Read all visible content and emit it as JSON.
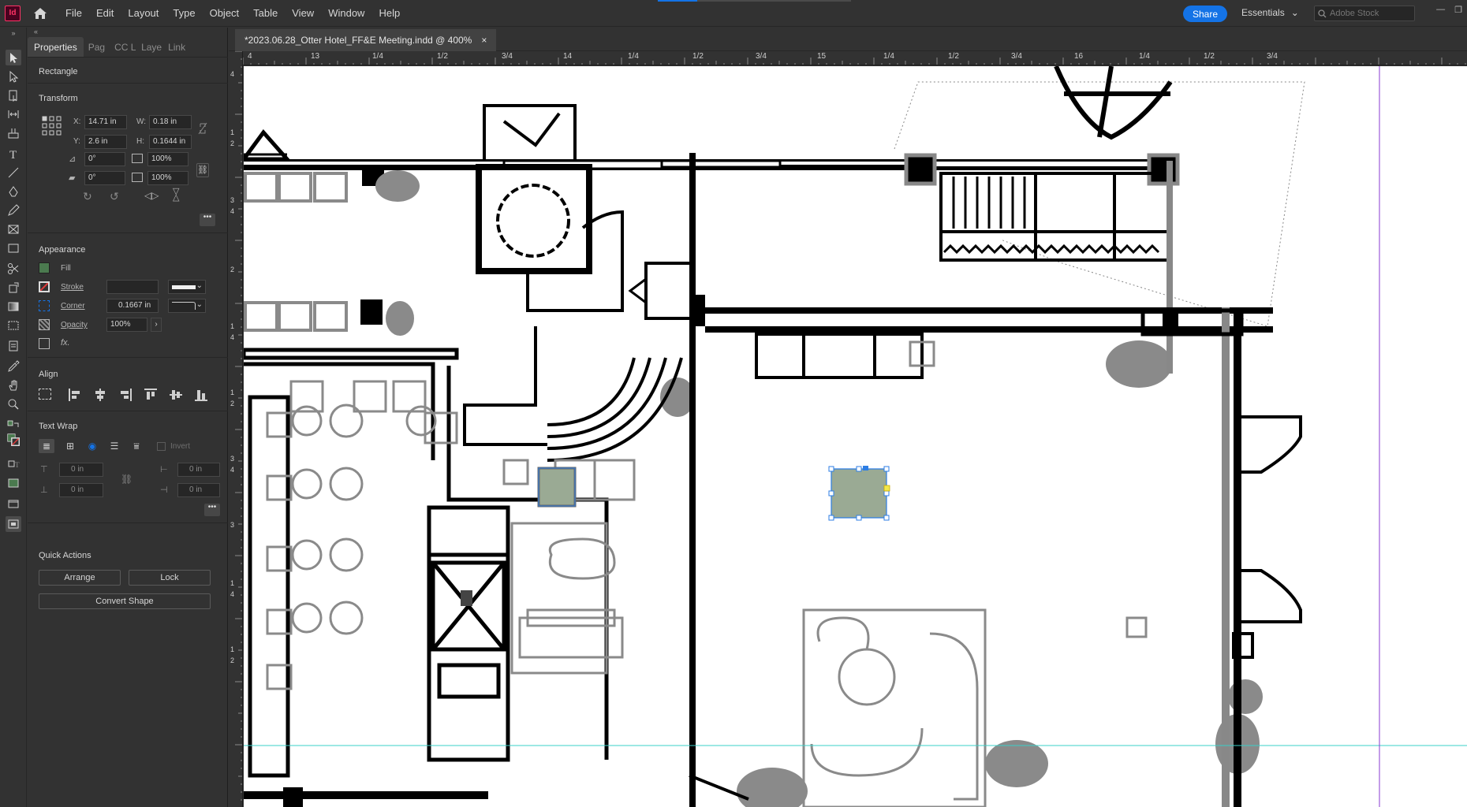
{
  "app": {
    "logo": "Id",
    "menu": [
      "File",
      "Edit",
      "Layout",
      "Type",
      "Object",
      "Table",
      "View",
      "Window",
      "Help"
    ],
    "share_label": "Share",
    "workspace_label": "Essentials",
    "stock_placeholder": "Adobe Stock"
  },
  "document": {
    "tab_title": "*2023.06.28_Otter Hotel_FF&E Meeting.indd @ 400%",
    "close_glyph": "×"
  },
  "panel": {
    "tabs": [
      "Properties",
      "Pag",
      "CC L",
      "Laye",
      "Link"
    ],
    "object_type": "Rectangle",
    "transform": {
      "title": "Transform",
      "x_label": "X:",
      "x": "14.71 in",
      "y_label": "Y:",
      "y": "2.6 in",
      "w_label": "W:",
      "w": "0.18 in",
      "h_label": "H:",
      "h": "0.1644 in",
      "rotate": "0°",
      "shear": "0°",
      "scale_x": "100%",
      "scale_y": "100%"
    },
    "appearance": {
      "title": "Appearance",
      "fill_label": "Fill",
      "fill_color": "#4b7a4f",
      "stroke_label": "Stroke",
      "corner_label": "Corner",
      "corner_value": "0.1667 in",
      "opacity_label": "Opacity",
      "opacity_value": "100%",
      "fx_label": "fx."
    },
    "align": {
      "title": "Align"
    },
    "text_wrap": {
      "title": "Text Wrap",
      "invert_label": "Invert",
      "top": "0 in",
      "bottom": "0 in",
      "left": "0 in",
      "right": "0 in"
    },
    "quick_actions": {
      "title": "Quick Actions",
      "arrange_label": "Arrange",
      "lock_label": "Lock",
      "convert_label": "Convert Shape"
    }
  },
  "rulers": {
    "top": [
      "4",
      "13",
      "1/4",
      "1/2",
      "3/4",
      "14",
      "1/4",
      "1/2",
      "3/4",
      "15",
      "1/4",
      "1/2",
      "3/4",
      "16",
      "1/4",
      "1/2",
      "3/4"
    ],
    "left": [
      "4",
      "1",
      "2",
      "3",
      "4",
      "2",
      "1",
      "4",
      "1",
      "2",
      "3",
      "4",
      "3",
      "1",
      "4",
      "1",
      "2"
    ]
  },
  "colors": {
    "accent": "#1473e6",
    "selection": "#2c7de4",
    "guide_cyan": "#39d0c8",
    "guide_purple": "#8a3ad0",
    "selected_fill": "#9aaa94"
  }
}
